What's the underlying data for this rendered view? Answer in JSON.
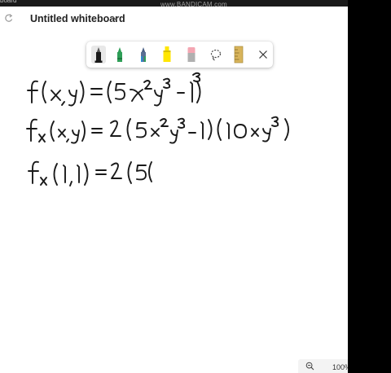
{
  "window": {
    "partial_app_title": "board"
  },
  "recording": {
    "watermark": "www.BANDICAM.com"
  },
  "header": {
    "title": "Untitled whiteboard"
  },
  "toolbar": {
    "tools": [
      {
        "name": "black-pen",
        "color": "#1a1a1a",
        "selected": true
      },
      {
        "name": "green-pen",
        "color": "#2e9e57"
      },
      {
        "name": "multicolor-pen",
        "color": "#7c8fb0"
      },
      {
        "name": "yellow-highlighter",
        "color": "#ffe600"
      },
      {
        "name": "eraser",
        "color": "#f4a6b2"
      },
      {
        "name": "lasso-select",
        "icon": "lasso-icon"
      },
      {
        "name": "ruler",
        "color": "#d8b45b"
      },
      {
        "name": "close",
        "icon": "close-icon"
      }
    ]
  },
  "canvas": {
    "ink_lines": [
      "f(x,y) = (5x²y³ − 1)³",
      "fx(x,y) = 2(5x²y³ − 1)(10xy³)",
      "fx(1,1) = 2(5("
    ]
  },
  "zoom": {
    "level": "100%"
  }
}
